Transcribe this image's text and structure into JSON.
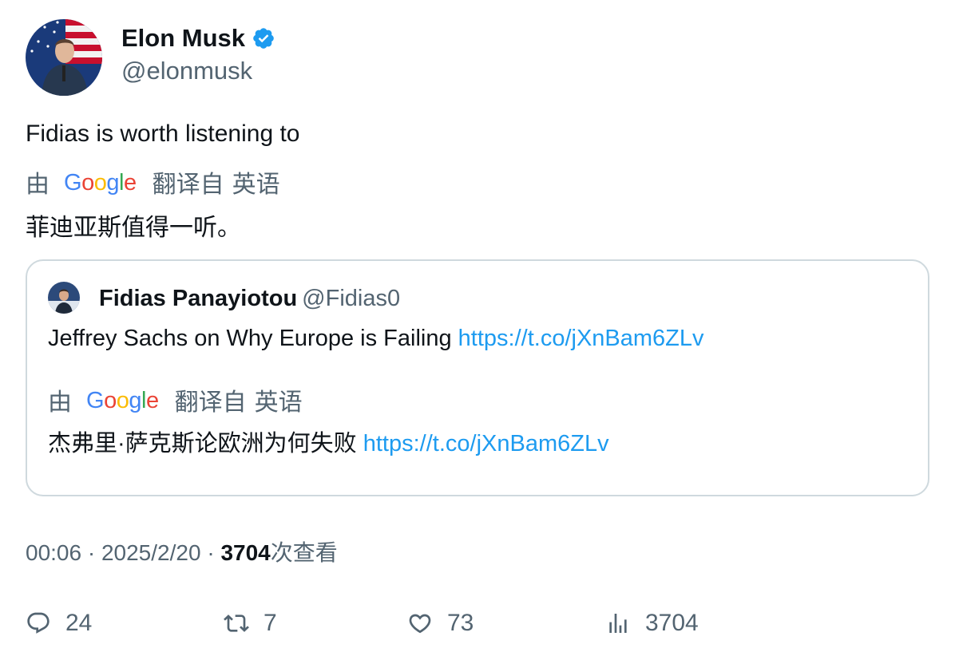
{
  "author": {
    "name": "Elon Musk",
    "handle": "@elonmusk"
  },
  "tweet": {
    "text": "Fidias is worth listening to",
    "translation": {
      "by": "由",
      "provider": "Google",
      "translated_from": "翻译自",
      "language": "英语",
      "text": "菲迪亚斯值得一听。"
    }
  },
  "quoted": {
    "name": "Fidias Panayiotou",
    "handle": "@Fidias0",
    "text": "Jeffrey Sachs on Why Europe is Failing",
    "link": "https://t.co/jXnBam6ZLv",
    "translation": {
      "by": "由",
      "provider": "Google",
      "translated_from": "翻译自",
      "language": "英语",
      "text": "杰弗里·萨克斯论欧洲为何失败",
      "link": "https://t.co/jXnBam6ZLv"
    }
  },
  "meta": {
    "time": "00:06",
    "separator": "·",
    "date": "2025/2/20",
    "views_count": "3704",
    "views_label": "次查看"
  },
  "actions": {
    "replies": "24",
    "retweets": "7",
    "likes": "73",
    "views": "3704"
  },
  "colors": {
    "accent": "#1d9bf0",
    "secondary_text": "#536471",
    "border": "#cfd9de"
  }
}
